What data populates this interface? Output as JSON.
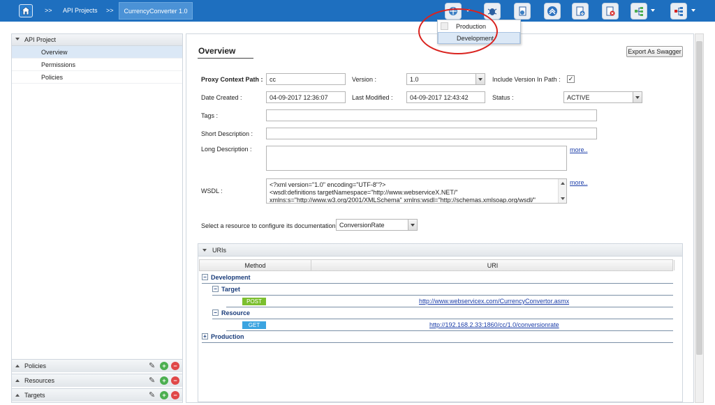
{
  "breadcrumb": {
    "sep1": ">>",
    "item1": "API Projects",
    "sep2": ">>",
    "active": "CurrencyConverter 1.0"
  },
  "toolbar": {
    "icons": [
      "deploy-icon",
      "debug-icon",
      "document-icon",
      "promote-icon",
      "export-icon",
      "delete-icon",
      "tree-icon",
      "hierarchy-icon"
    ]
  },
  "env_dropdown": {
    "options": [
      "Production",
      "Development"
    ],
    "selected": "Development"
  },
  "left_panel": {
    "title": "API Project",
    "items": [
      "Overview",
      "Permissions",
      "Policies"
    ],
    "selected": "Overview",
    "accordions": [
      "Policies",
      "Resources",
      "Targets"
    ]
  },
  "overview": {
    "title": "Overview",
    "export_label": "Export As Swagger",
    "proxy_context_label": "Proxy Context Path :",
    "proxy_context_value": "cc",
    "version_label": "Version :",
    "version_value": "1.0",
    "include_version_label": "Include Version In Path :",
    "include_version_checked": true,
    "date_created_label": "Date Created :",
    "date_created_value": "04-09-2017 12:36:07",
    "last_modified_label": "Last Modified :",
    "last_modified_value": "04-09-2017 12:43:42",
    "status_label": "Status :",
    "status_value": "ACTIVE",
    "tags_label": "Tags :",
    "tags_value": "",
    "short_desc_label": "Short Description :",
    "short_desc_value": "",
    "long_desc_label": "Long Description :",
    "long_desc_value": "",
    "more1": "more..",
    "wsdl_label": "WSDL :",
    "wsdl_lines": [
      "<?xml version=\"1.0\" encoding=\"UTF-8\"?>",
      "<wsdl:definitions targetNamespace=\"http://www.webserviceX.NET/\"",
      "xmlns:s=\"http://www.w3.org/2001/XMLSchema\" xmlns:wsdl=\"http://schemas.xmlsoap.org/wsdl/\""
    ],
    "more2": "more..",
    "resource_label": "Select a resource to configure its documentation :",
    "resource_value": "ConversionRate"
  },
  "uris": {
    "title": "URIs",
    "col_method": "Method",
    "col_uri": "URI",
    "development": "Development",
    "target": "Target",
    "target_method": "POST",
    "target_uri": "http://www.webservicex.com/CurrencyConvertor.asmx",
    "resource": "Resource",
    "resource_method": "GET",
    "resource_uri": "http://192.168.2.33:1860/cc/1.0/conversionrate",
    "production": "Production"
  },
  "colors": {
    "topbar": "#1e6fbf",
    "post_badge": "#7cbf2f",
    "get_badge": "#3ba4e0",
    "highlight_ring": "#d9231f"
  }
}
